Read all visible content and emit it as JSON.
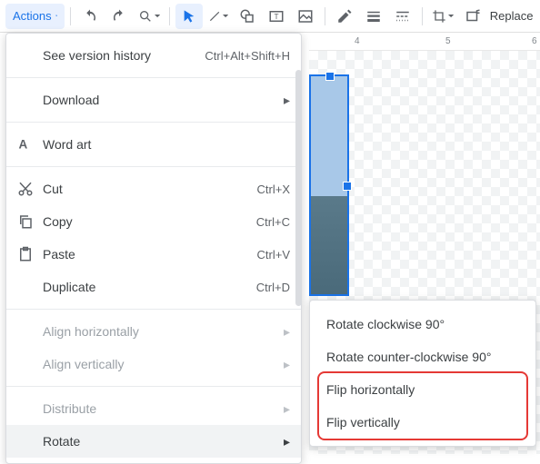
{
  "toolbar": {
    "actions_label": "Actions",
    "replace_label": "Replace"
  },
  "ruler": {
    "t4": "4",
    "t5": "5",
    "t6": "6"
  },
  "menu": {
    "version": {
      "label": "See version history",
      "shortcut": "Ctrl+Alt+Shift+H"
    },
    "download": {
      "label": "Download"
    },
    "wordart": {
      "label": "Word art"
    },
    "cut": {
      "label": "Cut",
      "shortcut": "Ctrl+X"
    },
    "copy": {
      "label": "Copy",
      "shortcut": "Ctrl+C"
    },
    "paste": {
      "label": "Paste",
      "shortcut": "Ctrl+V"
    },
    "duplicate": {
      "label": "Duplicate",
      "shortcut": "Ctrl+D"
    },
    "align_h": {
      "label": "Align horizontally"
    },
    "align_v": {
      "label": "Align vertically"
    },
    "distribute": {
      "label": "Distribute"
    },
    "rotate": {
      "label": "Rotate"
    }
  },
  "submenu": {
    "cw": "Rotate clockwise 90°",
    "ccw": "Rotate counter-clockwise 90°",
    "fliph": "Flip horizontally",
    "flipv": "Flip vertically"
  }
}
